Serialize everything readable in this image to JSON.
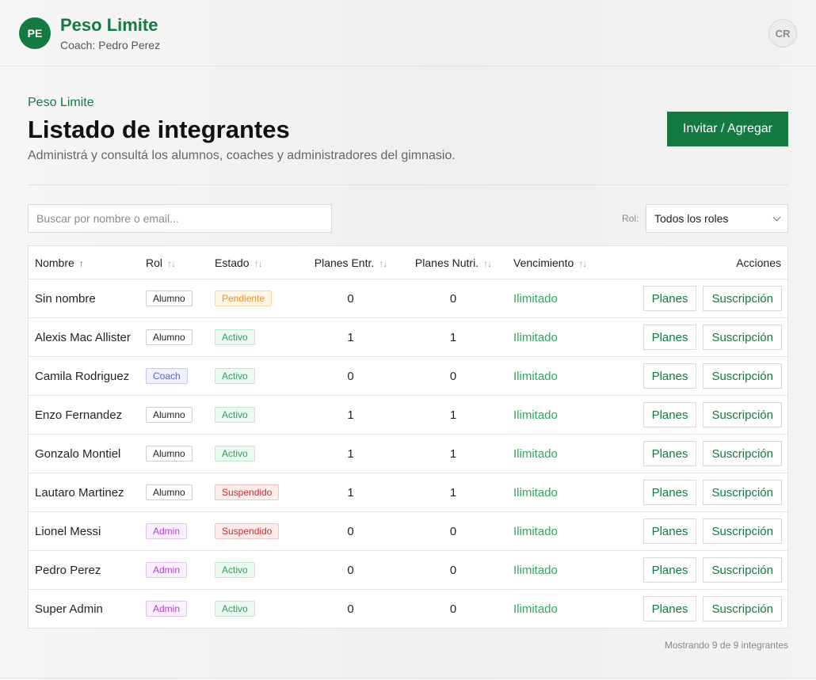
{
  "header": {
    "avatar_initials": "PE",
    "brand": "Peso Limite",
    "coach": "Coach: Pedro Perez",
    "user_initials": "CR"
  },
  "page": {
    "breadcrumb": "Peso Limite",
    "title": "Listado de integrantes",
    "subtitle": "Administrá y consultá los alumnos, coaches y administradores del gimnasio.",
    "invite_label": "Invitar / Agregar"
  },
  "filters": {
    "search_placeholder": "Buscar por nombre o email...",
    "search_value": "",
    "role_label": "Rol:",
    "role_value": "Todos los roles"
  },
  "table": {
    "columns": {
      "nombre": "Nombre",
      "rol": "Rol",
      "estado": "Estado",
      "planes_entr": "Planes Entr.",
      "planes_nutri": "Planes Nutri.",
      "vencimiento": "Vencimiento",
      "acciones": "Acciones"
    },
    "action_labels": {
      "planes": "Planes",
      "suscripcion": "Suscripción"
    },
    "rows": [
      {
        "nombre": "Sin nombre",
        "rol": "Alumno",
        "estado": "Pendiente",
        "planes_entr": "0",
        "planes_nutri": "0",
        "vencimiento": "Ilimitado"
      },
      {
        "nombre": "Alexis Mac Allister",
        "rol": "Alumno",
        "estado": "Activo",
        "planes_entr": "1",
        "planes_nutri": "1",
        "vencimiento": "Ilimitado"
      },
      {
        "nombre": "Camila Rodriguez",
        "rol": "Coach",
        "estado": "Activo",
        "planes_entr": "0",
        "planes_nutri": "0",
        "vencimiento": "Ilimitado"
      },
      {
        "nombre": "Enzo Fernandez",
        "rol": "Alumno",
        "estado": "Activo",
        "planes_entr": "1",
        "planes_nutri": "1",
        "vencimiento": "Ilimitado"
      },
      {
        "nombre": "Gonzalo Montiel",
        "rol": "Alumno",
        "estado": "Activo",
        "planes_entr": "1",
        "planes_nutri": "1",
        "vencimiento": "Ilimitado"
      },
      {
        "nombre": "Lautaro Martinez",
        "rol": "Alumno",
        "estado": "Suspendido",
        "planes_entr": "1",
        "planes_nutri": "1",
        "vencimiento": "Ilimitado"
      },
      {
        "nombre": "Lionel Messi",
        "rol": "Admin",
        "estado": "Suspendido",
        "planes_entr": "0",
        "planes_nutri": "0",
        "vencimiento": "Ilimitado"
      },
      {
        "nombre": "Pedro Perez",
        "rol": "Admin",
        "estado": "Activo",
        "planes_entr": "0",
        "planes_nutri": "0",
        "vencimiento": "Ilimitado"
      },
      {
        "nombre": "Super Admin",
        "rol": "Admin",
        "estado": "Activo",
        "planes_entr": "0",
        "planes_nutri": "0",
        "vencimiento": "Ilimitado"
      }
    ]
  },
  "footer": {
    "summary": "Mostrando 9 de 9 integrantes"
  },
  "colors": {
    "brand": "#137a41",
    "accent_green": "#2ea85c"
  }
}
